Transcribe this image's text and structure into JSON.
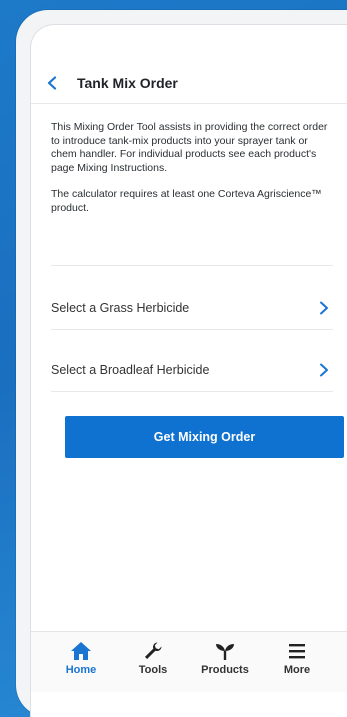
{
  "header": {
    "title": "Tank Mix Order"
  },
  "intro": {
    "paragraph1": "This Mixing Order Tool assists in providing the correct order to introduce tank-mix products into your sprayer tank or chem handler. For individual products see each product's page Mixing Instructions.",
    "paragraph2": "The calculator requires at least one Corteva Agriscience™ product."
  },
  "selects": [
    {
      "label": "Select a Grass Herbicide"
    },
    {
      "label": "Select a Broadleaf Herbicide"
    }
  ],
  "actions": {
    "get_mixing_order": "Get Mixing Order"
  },
  "tabbar": {
    "items": [
      {
        "label": "Home",
        "icon": "home-icon",
        "active": true
      },
      {
        "label": "Tools",
        "icon": "wrench-icon",
        "active": false
      },
      {
        "label": "Products",
        "icon": "sprout-icon",
        "active": false
      },
      {
        "label": "More",
        "icon": "menu-icon",
        "active": false
      }
    ]
  },
  "colors": {
    "accent": "#0f71d0",
    "background": "#1d7ac9",
    "active_tab": "#1a74d1"
  }
}
